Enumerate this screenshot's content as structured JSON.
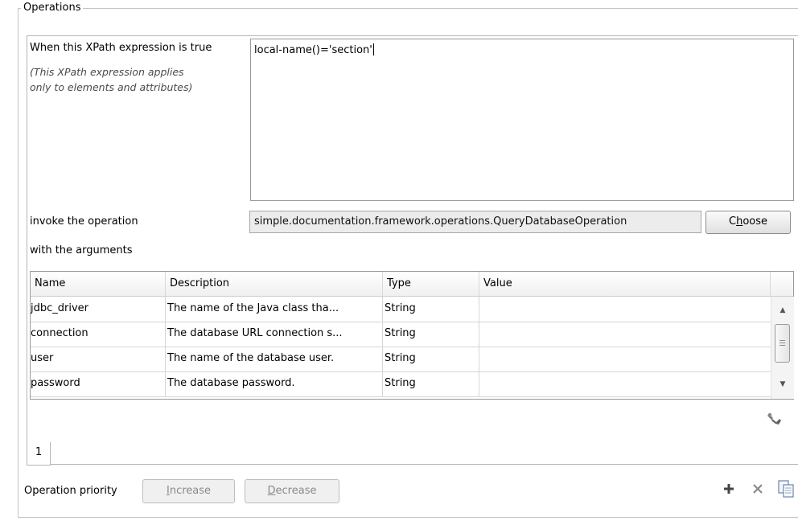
{
  "group_title": "Operations",
  "xpath": {
    "label": "When this XPath expression is true",
    "hint_line1": "(This XPath expression applies",
    "hint_line2": "only to elements and attributes)",
    "value": "local-name()='section'"
  },
  "operation": {
    "label": "invoke the operation",
    "value": "simple.documentation.framework.operations.QueryDatabaseOperation",
    "choose_label_pre": "C",
    "choose_label_ul": "h",
    "choose_label_post": "oose"
  },
  "arguments": {
    "label": "with the arguments",
    "columns": [
      "Name",
      "Description",
      "Type",
      "Value"
    ],
    "rows": [
      {
        "name": "jdbc_driver",
        "description": "The name of the Java class tha...",
        "type": "String",
        "value": ""
      },
      {
        "name": "connection",
        "description": "The database URL connection s...",
        "type": "String",
        "value": ""
      },
      {
        "name": "user",
        "description": "The name of the database user.",
        "type": "String",
        "value": ""
      },
      {
        "name": "password",
        "description": "The database password.",
        "type": "String",
        "value": ""
      }
    ]
  },
  "tabs": [
    "1"
  ],
  "priority": {
    "label": "Operation priority",
    "increase_ul": "I",
    "increase_rest": "ncrease",
    "decrease_ul": "D",
    "decrease_rest": "ecrease"
  },
  "icons": {
    "wrench": "wrench-icon",
    "add": "plus-icon",
    "remove": "close-icon",
    "duplicate": "copy-icon"
  },
  "colors": {
    "border": "#9a9a9a",
    "disabled_text": "#8a8a8a"
  }
}
